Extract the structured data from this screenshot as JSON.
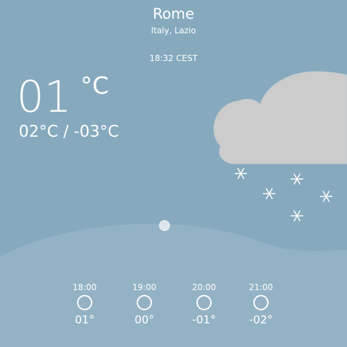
{
  "location": {
    "city": "Rome",
    "region": "Italy, Lazio",
    "time": "18:32 CEST"
  },
  "current": {
    "temperature": "01",
    "unit": "°C",
    "range": "02°C / -03°C",
    "condition_icon": "snow-cloud-icon"
  },
  "forecast": [
    {
      "time": "18:00",
      "temp": "01°",
      "icon": "clear-night-icon"
    },
    {
      "time": "19:00",
      "temp": "00°",
      "icon": "clear-night-icon"
    },
    {
      "time": "20:00",
      "temp": "-01°",
      "icon": "clear-night-icon"
    },
    {
      "time": "21:00",
      "temp": "-02°",
      "icon": "clear-night-icon"
    }
  ],
  "colors": {
    "background": "#86a9be",
    "hill": "#a1bacb",
    "cloud": "#cccccc",
    "text": "#ffffff"
  }
}
